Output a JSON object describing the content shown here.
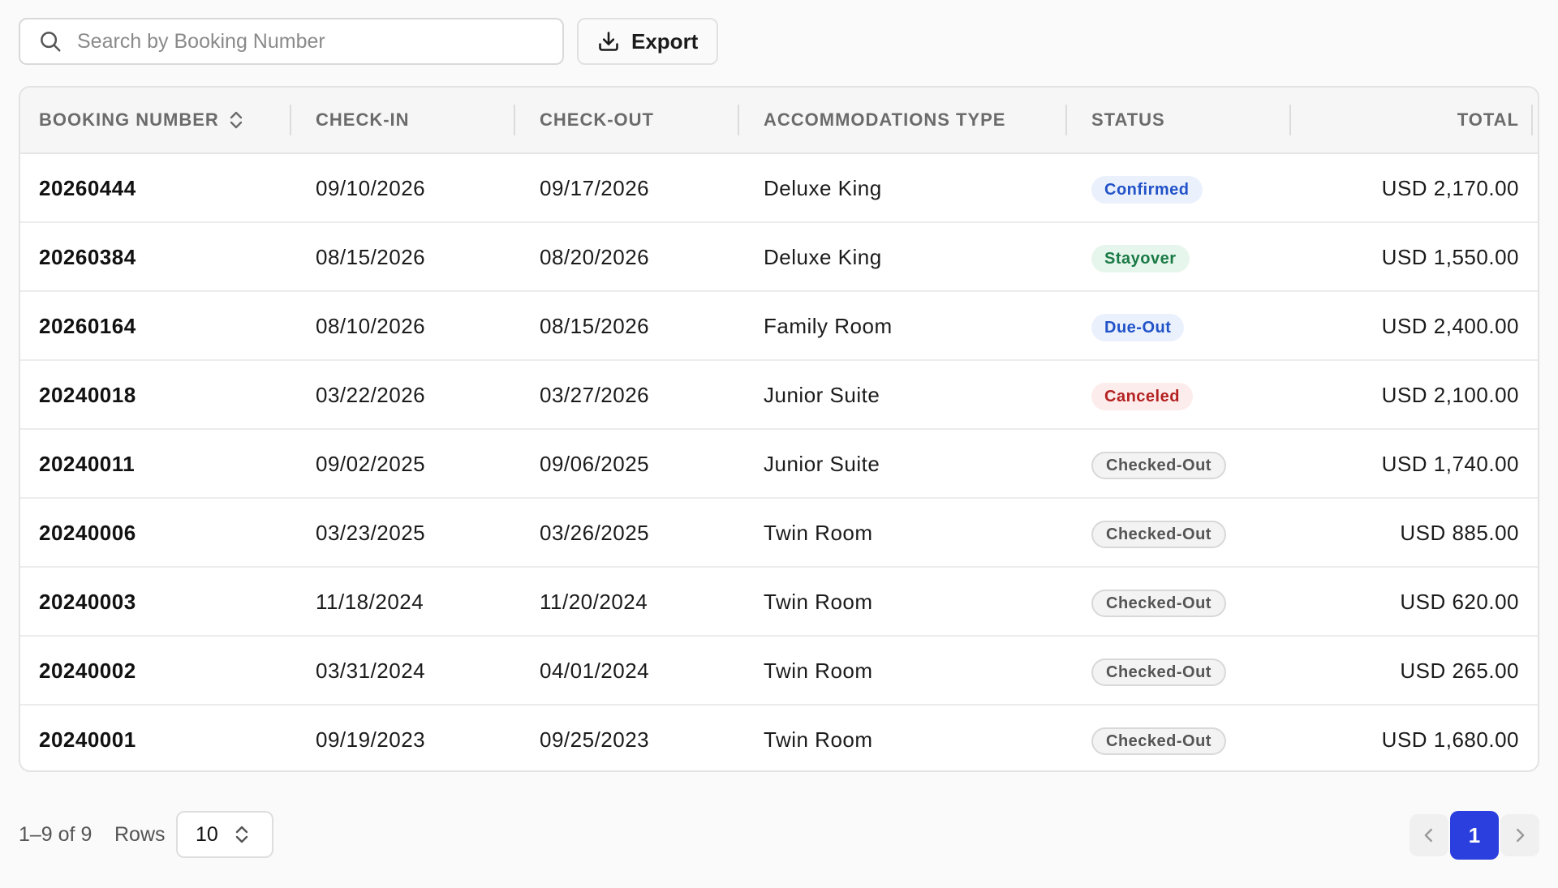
{
  "search": {
    "placeholder": "Search by Booking Number",
    "value": "",
    "icon": "search-icon"
  },
  "toolbar": {
    "export_label": "Export",
    "export_icon": "download-icon"
  },
  "table": {
    "columns": {
      "booking_number": "BOOKING NUMBER",
      "check_in": "CHECK-IN",
      "check_out": "CHECK-OUT",
      "accommodation": "ACCOMMODATIONS TYPE",
      "status": "STATUS",
      "total": "TOTAL"
    },
    "rows": [
      {
        "booking": "20260444",
        "check_in": "09/10/2026",
        "check_out": "09/17/2026",
        "type": "Deluxe King",
        "status": "Confirmed",
        "status_variant": "blue",
        "total": "USD 2,170.00"
      },
      {
        "booking": "20260384",
        "check_in": "08/15/2026",
        "check_out": "08/20/2026",
        "type": "Deluxe King",
        "status": "Stayover",
        "status_variant": "green",
        "total": "USD 1,550.00"
      },
      {
        "booking": "20260164",
        "check_in": "08/10/2026",
        "check_out": "08/15/2026",
        "type": "Family Room",
        "status": "Due-Out",
        "status_variant": "blue",
        "total": "USD 2,400.00"
      },
      {
        "booking": "20240018",
        "check_in": "03/22/2026",
        "check_out": "03/27/2026",
        "type": "Junior Suite",
        "status": "Canceled",
        "status_variant": "red",
        "total": "USD 2,100.00"
      },
      {
        "booking": "20240011",
        "check_in": "09/02/2025",
        "check_out": "09/06/2025",
        "type": "Junior Suite",
        "status": "Checked-Out",
        "status_variant": "gray",
        "total": "USD 1,740.00"
      },
      {
        "booking": "20240006",
        "check_in": "03/23/2025",
        "check_out": "03/26/2025",
        "type": "Twin Room",
        "status": "Checked-Out",
        "status_variant": "gray",
        "total": "USD 885.00"
      },
      {
        "booking": "20240003",
        "check_in": "11/18/2024",
        "check_out": "11/20/2024",
        "type": "Twin Room",
        "status": "Checked-Out",
        "status_variant": "gray",
        "total": "USD 620.00"
      },
      {
        "booking": "20240002",
        "check_in": "03/31/2024",
        "check_out": "04/01/2024",
        "type": "Twin Room",
        "status": "Checked-Out",
        "status_variant": "gray",
        "total": "USD 265.00"
      },
      {
        "booking": "20240001",
        "check_in": "09/19/2023",
        "check_out": "09/25/2023",
        "type": "Twin Room",
        "status": "Checked-Out",
        "status_variant": "gray",
        "total": "USD 1,680.00"
      }
    ]
  },
  "footer": {
    "range": "1–9 of 9",
    "rows_label": "Rows",
    "rows_value": "10",
    "current_page": "1"
  },
  "colors": {
    "accent": "#2a3fdd",
    "status_blue": "#2152c7",
    "status_green": "#1a7a45",
    "status_red": "#b42121",
    "status_gray": "#555555"
  }
}
